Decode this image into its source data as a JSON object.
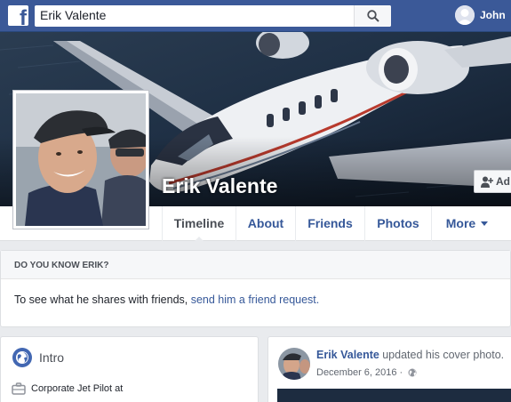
{
  "topbar": {
    "logo": "facebook-f-logo",
    "search_value": "Erik Valente",
    "search_icon": "search-icon",
    "user_name": "John"
  },
  "profile": {
    "name": "Erik Valente",
    "add_friend_label": "Ad"
  },
  "tabs": [
    {
      "label": "Timeline",
      "active": true
    },
    {
      "label": "About"
    },
    {
      "label": "Friends"
    },
    {
      "label": "Photos"
    },
    {
      "label": "More"
    }
  ],
  "know_card": {
    "title": "DO YOU KNOW ERIK?",
    "text": "To see what he shares with friends, ",
    "link": "send him a friend request."
  },
  "intro": {
    "title": "Intro",
    "work": "Corporate Jet Pilot at"
  },
  "post": {
    "author": "Erik Valente",
    "action": "updated his cover photo.",
    "date": "December 6, 2016 ·"
  },
  "colors": {
    "brand_blue": "#3b5998",
    "link_blue": "#365899",
    "background": "#e9ebee"
  }
}
